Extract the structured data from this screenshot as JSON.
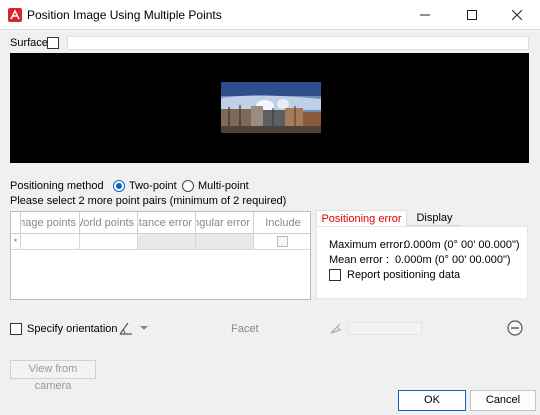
{
  "window": {
    "title": "Position Image Using Multiple Points",
    "minimize_icon": "minimize-icon",
    "maximize_icon": "maximize-icon",
    "close_icon": "close-icon"
  },
  "surface": {
    "label": "Surface",
    "checked": false,
    "value": ""
  },
  "positioning_method": {
    "label": "Positioning method",
    "options": [
      {
        "label": "Two-point",
        "selected": true
      },
      {
        "label": "Multi-point",
        "selected": false
      }
    ]
  },
  "hint": "Please select 2 more point pairs (minimum of 2 required)",
  "table": {
    "columns": [
      "Image points",
      "World points",
      "Distance error",
      "Angular error",
      "Include"
    ],
    "new_row_marker": "*"
  },
  "tabs": [
    {
      "label": "Positioning error",
      "active": true
    },
    {
      "label": "Display",
      "active": false
    }
  ],
  "error_panel": {
    "max_label": "Maximum error:",
    "max_value": "0.000m (0° 00' 00.000\")",
    "mean_label": "Mean error :",
    "mean_value": "0.000m (0° 00' 00.000\")",
    "report_label": "Report positioning data",
    "report_checked": false
  },
  "orientation": {
    "label": "Specify orientation",
    "checked": false,
    "facet_label": "Facet",
    "facet_value": ""
  },
  "buttons": {
    "view_from_camera": "View from camera",
    "ok": "OK",
    "cancel": "Cancel"
  },
  "colors": {
    "accent": "#0a64c8",
    "brand": "#d9242a",
    "error_tab": "#e00000"
  }
}
